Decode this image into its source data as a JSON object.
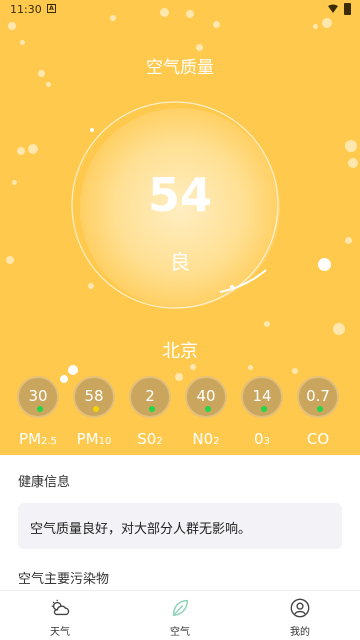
{
  "status_bar": {
    "time": "11:30",
    "notif": "A"
  },
  "header": {
    "title": "空气质量"
  },
  "aqi": {
    "value": "54",
    "level": "良"
  },
  "city": "北京",
  "pollutants": [
    {
      "value": "30",
      "label": "PM",
      "sub": "2.5",
      "level_color": "#22d64a"
    },
    {
      "value": "58",
      "label": "PM",
      "sub": "10",
      "level_color": "#f5d300"
    },
    {
      "value": "2",
      "label": "S0",
      "sub": "2",
      "level_color": "#22d64a"
    },
    {
      "value": "40",
      "label": "N0",
      "sub": "2",
      "level_color": "#22d64a"
    },
    {
      "value": "14",
      "label": "0",
      "sub": "3",
      "level_color": "#22d64a"
    },
    {
      "value": "0.7",
      "label": "CO",
      "sub": "",
      "level_color": "#22d64a"
    }
  ],
  "health": {
    "title": "健康信息",
    "text": "空气质量良好，对大部分人群无影响。"
  },
  "main_pollutant": {
    "title": "空气主要污染物"
  },
  "nav": {
    "items": [
      {
        "label": "天气",
        "icon": "weather-icon"
      },
      {
        "label": "空气",
        "icon": "leaf-icon"
      },
      {
        "label": "我的",
        "icon": "profile-icon"
      }
    ]
  },
  "colors": {
    "hero_bg": "#FFC94D",
    "active_nav": "#8fd3b8"
  }
}
